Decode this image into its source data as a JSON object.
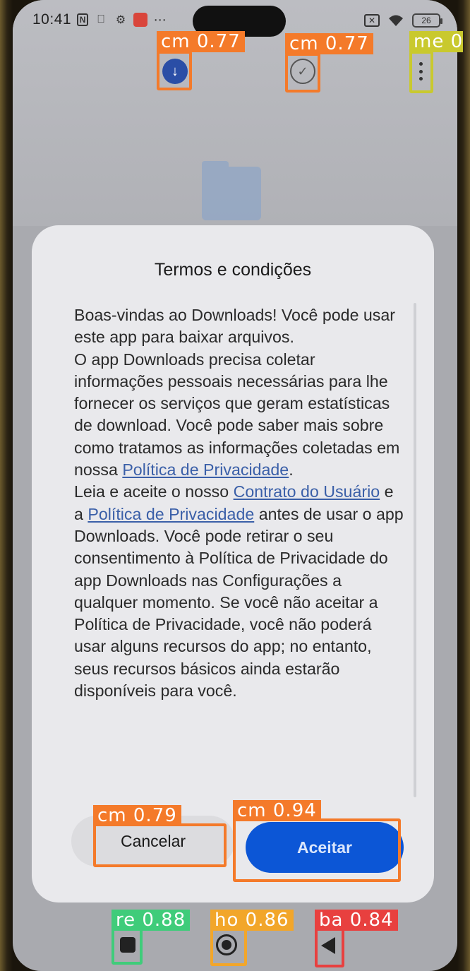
{
  "status_bar": {
    "time": "10:41",
    "battery_level": "26",
    "icons": [
      "nfc-icon",
      "sim-icon",
      "gear-icon",
      "app-notification-icon",
      "more-dots-icon",
      "sim-x-icon",
      "wifi-icon",
      "battery-icon"
    ]
  },
  "toolbar": {
    "download_icon": "download-icon",
    "check_icon": "check-circle-icon",
    "menu_icon": "more-vert-icon"
  },
  "dialog": {
    "title": "Termos e condições",
    "body": {
      "l1": "Boas-vindas ao Downloads! Você pode usar este app para baixar arquivos.",
      "l2": "O app Downloads precisa coletar informações pessoais necessárias para lhe fornecer os serviços que geram estatísticas de download. Você pode saber mais sobre como tratamos as informações coletadas em nossa",
      "privacy_link_1": "Política de Privacidade",
      "l3": "Leia e aceite o nosso",
      "user_agreement_link": "Contrato do Usuário",
      "l4": "e a",
      "privacy_link_2": "Política de Privacidade",
      "l5": "antes de usar o app Downloads. Você pode retirar o seu consentimento à Política de Privacidade do app Downloads nas Configurações a qualquer momento. Se você não aceitar a Política de Privacidade, você não poderá usar alguns recursos do app; no entanto, seus recursos básicos ainda estarão disponíveis para você."
    },
    "cancel_label": "Cancelar",
    "accept_label": "Aceitar"
  },
  "detections": [
    {
      "label": "cm 0.77",
      "color": "#f47a2a"
    },
    {
      "label": "cm 0.77",
      "color": "#f47a2a"
    },
    {
      "label": "me 0",
      "color": "#c9c92e"
    },
    {
      "label": "cm 0.79",
      "color": "#f47a2a"
    },
    {
      "label": "cm 0.94",
      "color": "#f47a2a"
    },
    {
      "label": "re 0.88",
      "color": "#3fcc7a"
    },
    {
      "label": "ho 0.86",
      "color": "#f2a62a"
    },
    {
      "label": "ba 0.84",
      "color": "#e8403f"
    }
  ],
  "nav_bar": {
    "recent_icon": "recent-apps-icon",
    "home_icon": "home-icon",
    "back_icon": "back-icon"
  },
  "colors": {
    "accent": "#0c56d6",
    "link": "#3a5fa8",
    "dialog_bg": "#e9e9ec"
  }
}
